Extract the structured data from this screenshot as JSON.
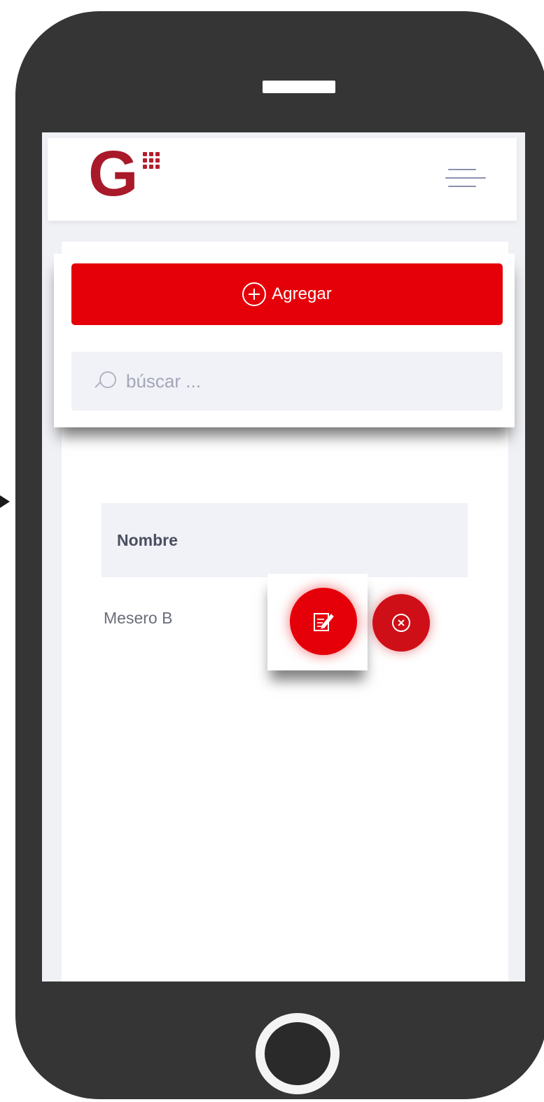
{
  "brand": {
    "logo_letter": "G",
    "logo_color": "#a8192a"
  },
  "header": {
    "menu_icon": "hamburger-menu-icon"
  },
  "toolbar": {
    "add_label": "Agregar",
    "add_icon": "plus-circle-icon",
    "accent_color": "#e50009"
  },
  "search": {
    "placeholder": "búscar ...",
    "icon": "search-icon"
  },
  "table": {
    "columns": [
      "Nombre"
    ],
    "rows": [
      {
        "name": "Mesero B",
        "actions": [
          "edit-icon",
          "delete-icon"
        ]
      }
    ]
  }
}
